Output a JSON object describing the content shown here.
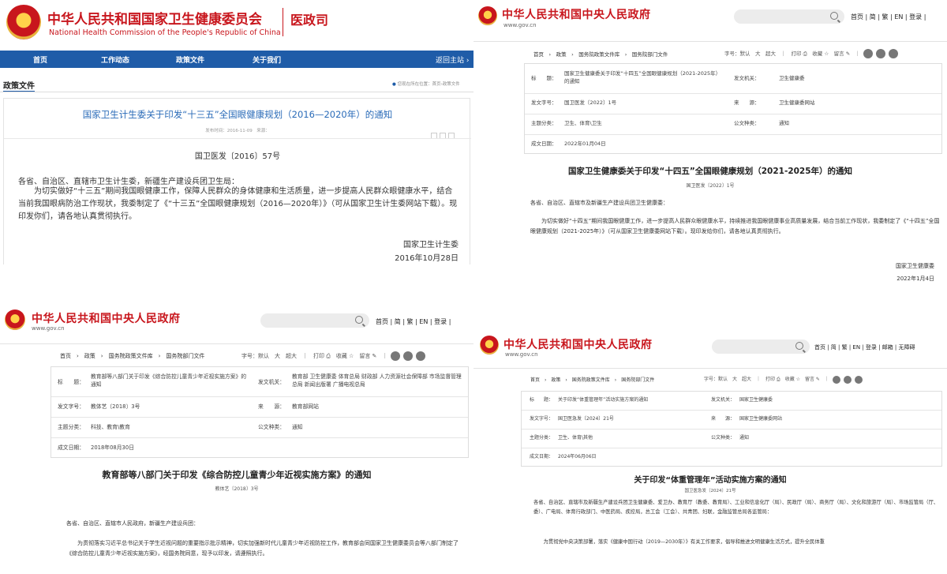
{
  "q1": {
    "org_cn": "中华人民共和国国家卫生健康委员会",
    "org_en": "National Health Commission of the People's Republic of China",
    "dept": "医政司",
    "nav": [
      "首页",
      "工作动态",
      "政策文件",
      "关于我们"
    ],
    "back": "返回主站 ›",
    "section": "政策文件",
    "location": "您现在所在位置：首页›政策文件",
    "title": "国家卫生计生委关于印发“十三五”全国眼健康规划（2016—2020年）的通知",
    "meta": "发布时间：2016-11-09　来源：",
    "doc_no": "国卫医发〔2016〕57号",
    "p1": "各省、自治区、直辖市卫生计生委，新疆生产建设兵团卫生局：",
    "p2": "　　为切实做好“十三五”期间我国眼健康工作，保障人民群众的身体健康和生活质量，进一步提高人民群众眼健康水平，结合当前我国眼病防治工作现状，我委制定了《“十三五”全国眼健康规划（2016—2020年）》（可从国家卫生计生委网站下载）。现印发你们，请各地认真贯彻执行。",
    "sign": "国家卫生计生委",
    "date": "2016年10月28日"
  },
  "gov": {
    "title": "中华人民共和国中央人民政府",
    "url": "www.gov.cn",
    "links_a": "首页 | 简 | 繁 | EN | 登录 |",
    "links_b": "首页 | 简 | 繁 | EN | 登录 | 邮箱 | 无障碍",
    "crumb": "首页　›　政策　›　国务院政策文件库　›　国务院部门文件",
    "tools": "字号：默认　大　超大　｜　打印 ⎙　收藏 ☆　留言 ✎　｜",
    "labels": {
      "title": "标　　题：",
      "org": "发文机关：",
      "no": "发文字号：",
      "src": "来　　源：",
      "topic": "主题分类：",
      "kind": "公文种类：",
      "date": "成文日期："
    }
  },
  "q2": {
    "t_title": "国家卫生健康委关于印发“十四五”全国眼健康规划（2021-2025年）的通知",
    "t_org": "卫生健康委",
    "t_no": "国卫医发〔2022〕1号",
    "t_src": "卫生健康委网站",
    "t_topic": "卫生、体育\\卫生",
    "t_kind": "通知",
    "t_date": "2022年01月04日",
    "heading": "国家卫生健康委关于印发“十四五”全国眼健康规划（2021-2025年）的通知",
    "doc_no": "国卫医发〔2022〕1号",
    "p1": "各省、自治区、直辖市及新疆生产建设兵团卫生健康委：",
    "p2": "　　为切实做好“十四五”期间我国眼健康工作，进一步提高人民群众眼健康水平，持续推进我国眼健康事业高质量发展，结合当前工作现状，我委制定了《“十四五”全国眼健康规划（2021-2025年）》（可从国家卫生健康委网站下载）。现印发给你们，请各地认真贯彻执行。",
    "sign": "国家卫生健康委",
    "date": "2022年1月4日"
  },
  "q3": {
    "t_title": "教育部等八部门关于印发《综合防控儿童青少年近视实施方案》的通知",
    "t_org": "教育部 卫生健康委 体育总局 财政部 人力资源社会保障部 市场监督管理总局 新闻出版署 广播电视总局",
    "t_no": "教体艺〔2018〕3号",
    "t_src": "教育部网站",
    "t_topic": "科技、教育\\教育",
    "t_kind": "通知",
    "t_date": "2018年08月30日",
    "heading": "教育部等八部门关于印发《综合防控儿童青少年近视实施方案》的通知",
    "doc_no": "教体艺〔2018〕3号",
    "p1": "各省、自治区、直辖市人民政府，新疆生产建设兵团：",
    "p2": "　　为贯彻落实习近平总书记关于学生近视问题的重要指示批示精神，切实加强新时代儿童青少年近视防控工作，教育部会同国家卫生健康委员会等八部门制定了《综合防控儿童青少年近视实施方案》，经国务院同意，现予以印发，请遵照执行。"
  },
  "q4": {
    "t_title": "关于印发“体重管理年”活动实施方案的通知",
    "t_org": "国家卫生健康委",
    "t_no": "国卫医急发〔2024〕21号",
    "t_src": "国家卫生健康委网站",
    "t_topic": "卫生、体育\\其他",
    "t_kind": "通知",
    "t_date": "2024年06月06日",
    "heading": "关于印发“体重管理年”活动实施方案的通知",
    "doc_no": "国卫医急发〔2024〕21号",
    "p1": "各省、自治区、直辖市及新疆生产建设兵团卫生健康委、爱卫办、教育厅（教委、教育局）、工业和信息化厅（局）、民政厅（局）、商务厅（局）、文化和旅游厅（局）、市场监管局（厅、委）、广电局、体育行政部门、中医药局、疾控局，总工会（工会）、共青团、妇联，金融监管总局各监管局：",
    "p2": "　　为贯彻党中央决策部署，落实《健康中国行动（2019—2030年）》有关工作要求，倡导和推进文明健康生活方式，提升全民体重"
  },
  "colors": {
    "red": "#c8161d",
    "nav_blue": "#1f5ca8",
    "link_blue": "#2a6bb8"
  }
}
